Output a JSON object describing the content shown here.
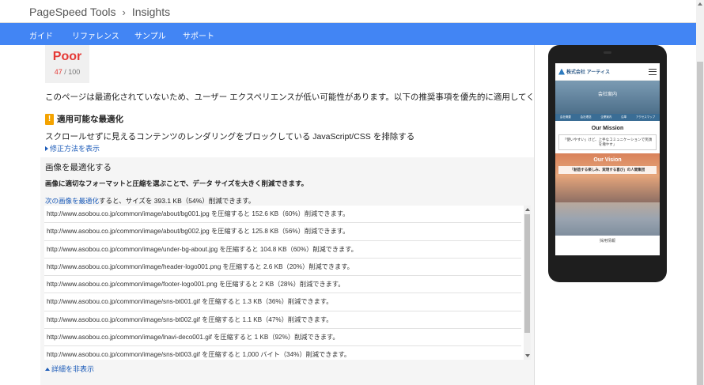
{
  "header": {
    "tool": "PageSpeed Tools",
    "separator": "›",
    "page": "Insights"
  },
  "nav": [
    "ガイド",
    "リファレンス",
    "サンプル",
    "サポート"
  ],
  "score": {
    "label": "Poor",
    "value": "47",
    "max": "/ 100"
  },
  "summary": "このページは最適化されていないため、ユーザー エクスペリエンスが低い可能性があります。以下の推奨事項を優先的に適用してください。",
  "section": {
    "heading": "適用可能な最適化",
    "rule": "スクロールせずに見えるコンテンツのレンダリングをブロックしている JavaScript/CSS を排除する",
    "howto": "修正方法を表示"
  },
  "panel": {
    "title": "画像を最適化する",
    "desc": "画像に適切なフォーマットと圧縮を選ぶことで、データ サイズを大きく削減できます。",
    "lead_link": "次の画像を最適化",
    "lead_rest": "すると、サイズを 393.1 KB（54%）削減できます。",
    "rows": [
      "http://www.asobou.co.jp/common/image/about/bg001.jpg を圧縮すると 152.6 KB（60%）削減できます。",
      "http://www.asobou.co.jp/common/image/about/bg002.jpg を圧縮すると 125.8 KB（56%）削減できます。",
      "http://www.asobou.co.jp/common/image/under-bg-about.jpg を圧縮すると 104.8 KB（60%）削減できます。",
      "http://www.asobou.co.jp/common/image/header-logo001.png を圧縮すると 2.6 KB（20%）削減できます。",
      "http://www.asobou.co.jp/common/image/footer-logo001.png を圧縮すると 2 KB（28%）削減できます。",
      "http://www.asobou.co.jp/common/image/sns-bt001.gif を圧縮すると 1.3 KB（36%）削減できます。",
      "http://www.asobou.co.jp/common/image/sns-bt002.gif を圧縮すると 1.1 KB（47%）削減できます。",
      "http://www.asobou.co.jp/common/image/lnavi-deco001.gif を圧縮すると 1 KB（92%）削減できます。",
      "http://www.asobou.co.jp/common/image/sns-bt003.gif を圧縮すると 1,000 バイト（34%）削減できます。"
    ],
    "hide_details": "詳細を非表示"
  },
  "mobile": {
    "company": "株式会社 アーティス",
    "hero": "会社案内",
    "tabs": [
      "会社概要",
      "会社理念",
      "企業案内",
      "沿革",
      "アクセスマップ"
    ],
    "mission_title": "Our Mission",
    "mission_text": "「使いやすい」けど、上手なコミュニケーションで笑顔を増やす」",
    "vision_title": "Our Vision",
    "vision_box": "「創造する楽しみ、実現する喜び」の人間集団",
    "footer": "採用情報"
  }
}
